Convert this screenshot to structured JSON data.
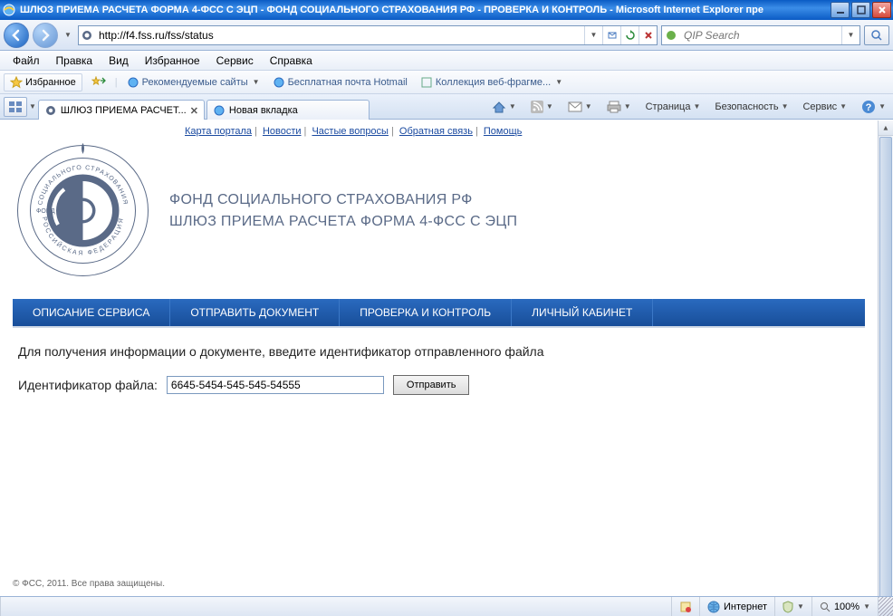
{
  "window": {
    "title": "ШЛЮЗ ПРИЕМА РАСЧЕТА ФОРМА 4-ФСС С ЭЦП - ФОНД СОЦИАЛЬНОГО СТРАХОВАНИЯ РФ - ПРОВЕРКА И КОНТРОЛЬ - Microsoft Internet Explorer пре"
  },
  "address": {
    "url": "http://f4.fss.ru/fss/status"
  },
  "search": {
    "placeholder": "QIP Search"
  },
  "menu": {
    "items": [
      "Файл",
      "Правка",
      "Вид",
      "Избранное",
      "Сервис",
      "Справка"
    ]
  },
  "favorites": {
    "button": "Избранное",
    "links": [
      {
        "label": "Рекомендуемые сайты",
        "has_dd": true
      },
      {
        "label": "Бесплатная почта Hotmail",
        "has_dd": false
      },
      {
        "label": "Коллекция веб-фрагме...",
        "has_dd": true
      }
    ]
  },
  "tabs": [
    {
      "title": "ШЛЮЗ ПРИЕМА РАСЧЕТ...",
      "active": true
    },
    {
      "title": "Новая вкладка",
      "active": false
    }
  ],
  "tabbar_tools": {
    "page": "Страница",
    "security": "Безопасность",
    "service": "Сервис"
  },
  "page": {
    "top_links": [
      "Карта портала",
      "Новости",
      "Частые вопросы",
      "Обратная связь",
      "Помощь"
    ],
    "heading1": "ФОНД СОЦИАЛЬНОГО СТРАХОВАНИЯ РФ",
    "heading2": "ШЛЮЗ ПРИЕМА РАСЧЕТА ФОРМА 4-ФСС С ЭЦП",
    "nav": [
      "ОПИСАНИЕ СЕРВИСА",
      "ОТПРАВИТЬ ДОКУМЕНТ",
      "ПРОВЕРКА И КОНТРОЛЬ",
      "ЛИЧНЫЙ КАБИНЕТ"
    ],
    "prompt": "Для получения информации о документе, введите идентификатор отправленного файла",
    "field_label": "Идентификатор файла:",
    "field_value": "6645-5454-545-545-54555",
    "submit": "Отправить",
    "footer": "© ФСС, 2011. Все права защищены."
  },
  "status": {
    "zone": "Интернет",
    "zoom": "100%"
  }
}
